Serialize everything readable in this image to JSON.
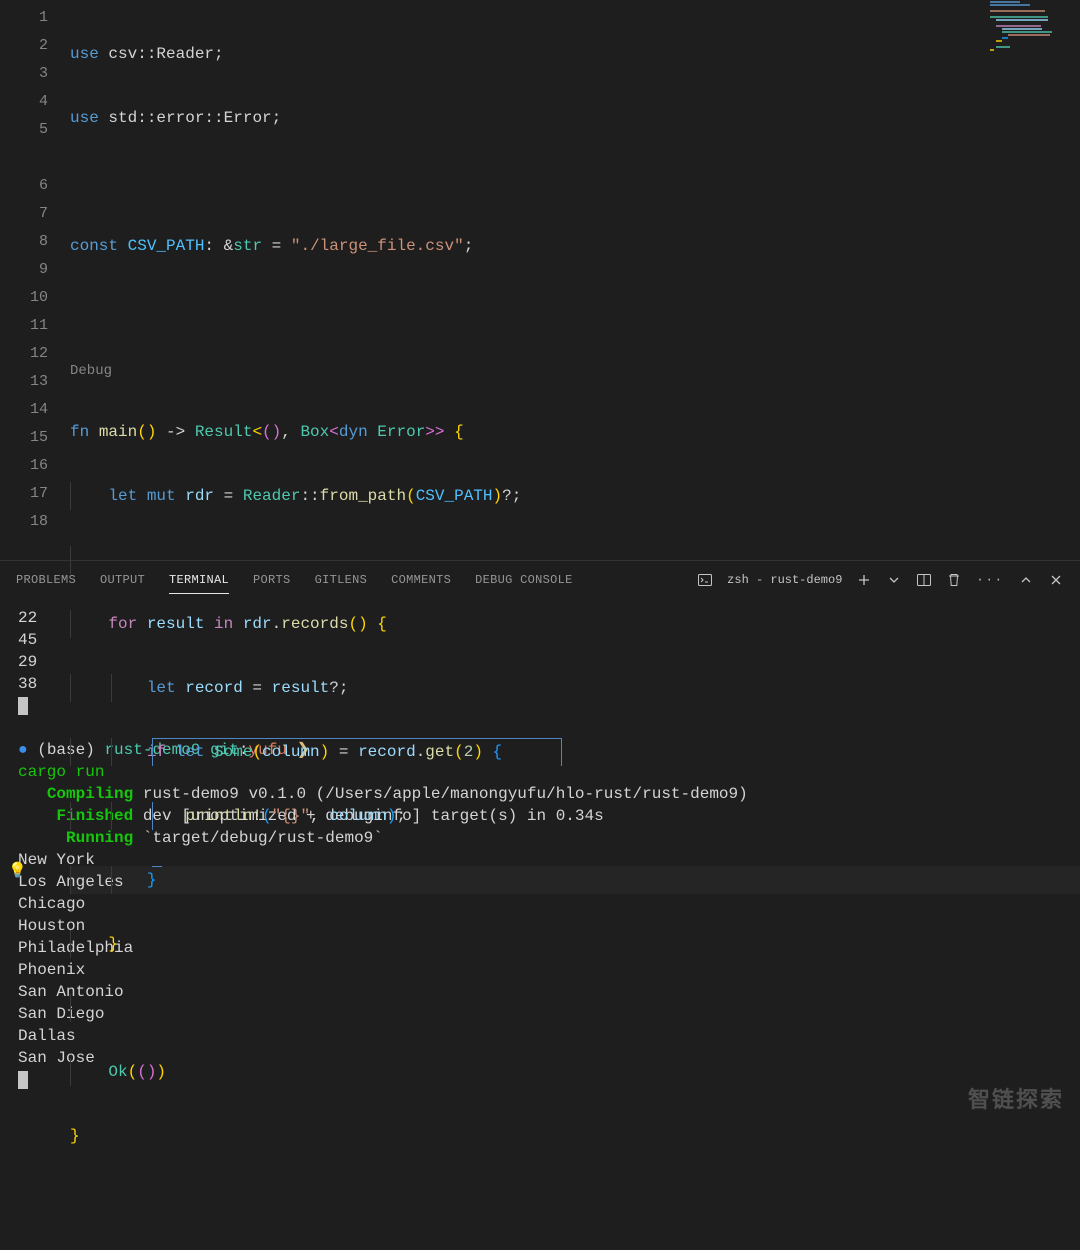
{
  "editor": {
    "line_numbers": [
      "1",
      "2",
      "3",
      "4",
      "5",
      "",
      "6",
      "7",
      "8",
      "9",
      "10",
      "11",
      "12",
      "13",
      "14",
      "15",
      "16",
      "17",
      "18"
    ],
    "codelens": "Debug",
    "code": {
      "l1": {
        "a": "use",
        "b": " csv::Reader;"
      },
      "l2": {
        "a": "use",
        "b": " std::error::Error;"
      },
      "l4": {
        "a": "const ",
        "b": "CSV_PATH",
        "c": ": &",
        "d": "str",
        "e": " = ",
        "f": "\"./large_file.csv\"",
        "g": ";"
      },
      "l6": {
        "a": "fn ",
        "b": "main",
        "c": "()",
        "d": " -> ",
        "e": "Result",
        "f": "<",
        "g": "()",
        "h": ", ",
        "i": "Box",
        "j": "<",
        "k": "dyn ",
        "l": "Error",
        "m": ">>",
        "n": " {"
      },
      "l7": {
        "a": "let ",
        "b": "mut ",
        "c": "rdr",
        "d": " = ",
        "e": "Reader",
        "f": "::",
        "g": "from_path",
        "h": "(",
        "i": "CSV_PATH",
        "j": ")",
        "k": "?;"
      },
      "l9": {
        "a": "for ",
        "b": "result",
        "c": " in ",
        "d": "rdr",
        "e": ".",
        "f": "records",
        "g": "()",
        "h": " {"
      },
      "l10": {
        "a": "let ",
        "b": "record",
        "c": " = ",
        "d": "result",
        "e": "?;"
      },
      "l11": {
        "a": "if ",
        "b": "let ",
        "c": "Some",
        "d": "(",
        "e": "column",
        "f": ")",
        "g": " = ",
        "h": "record",
        "i": ".",
        "j": "get",
        "k": "(",
        "l": "2",
        "m": ")",
        "n": " {"
      },
      "l12": {
        "a": "println!",
        "b": "(",
        "c": "\"{}\"",
        "d": ", ",
        "e": "column",
        "f": ")",
        "g": ";"
      },
      "l13": {
        "a": "}"
      },
      "l14": {
        "a": "}"
      },
      "l16": {
        "a": "Ok",
        "b": "(",
        "c": "()",
        "d": ")"
      },
      "l17": {
        "a": "}"
      }
    }
  },
  "panel": {
    "tabs": [
      "PROBLEMS",
      "OUTPUT",
      "TERMINAL",
      "PORTS",
      "GITLENS",
      "COMMENTS",
      "DEBUG CONSOLE"
    ],
    "active_tab": "TERMINAL",
    "shell": "zsh - rust-demo9"
  },
  "terminal": {
    "prev_output": [
      "22",
      "45",
      "29",
      "38"
    ],
    "prompt": {
      "dot": "●",
      "env": "(base)",
      "dir": "rust-demo9",
      "git": "git",
      "colon": ":",
      "branch": "yufu",
      "arrow": "❯"
    },
    "cmd": "cargo run",
    "compiling": {
      "label": "Compiling",
      "rest": " rust-demo9 v0.1.0 (/Users/apple/manongyufu/hlo-rust/rust-demo9)"
    },
    "finished": {
      "label": "Finished",
      "rest": " dev [unoptimized + debuginfo] target(s) in 0.34s"
    },
    "running": {
      "label": "Running",
      "rest": " `target/debug/rust-demo9`"
    },
    "output": [
      "New York",
      "Los Angeles",
      "Chicago",
      "Houston",
      "Philadelphia",
      "Phoenix",
      "San Antonio",
      "San Diego",
      "Dallas",
      "San Jose"
    ]
  },
  "watermark": "智链探索"
}
